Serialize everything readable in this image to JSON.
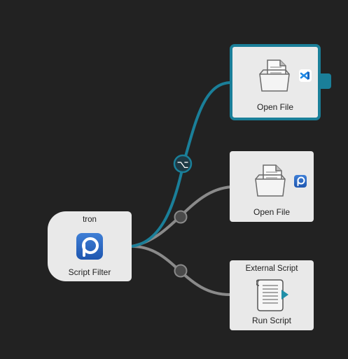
{
  "canvas": {
    "background": "#222222",
    "accent": "#1a7f99",
    "connection_color": "#8a8a8a"
  },
  "nodes": {
    "trigger": {
      "keyword": "tron",
      "type_label": "Script Filter",
      "icon": "tron-app-icon"
    },
    "open_vscode": {
      "type_label": "Open File",
      "icon": "open-file-icon",
      "badge": "vscode-icon",
      "selected": true
    },
    "open_tron": {
      "type_label": "Open File",
      "icon": "open-file-icon",
      "badge": "tron-app-icon"
    },
    "run_script": {
      "title": "External Script",
      "type_label": "Run Script",
      "icon": "run-script-icon"
    }
  },
  "connections": [
    {
      "from": "trigger",
      "to": "open_vscode",
      "modifier": "⌥",
      "highlighted": true
    },
    {
      "from": "trigger",
      "to": "open_tron",
      "modifier": ""
    },
    {
      "from": "trigger",
      "to": "run_script",
      "modifier": ""
    }
  ]
}
